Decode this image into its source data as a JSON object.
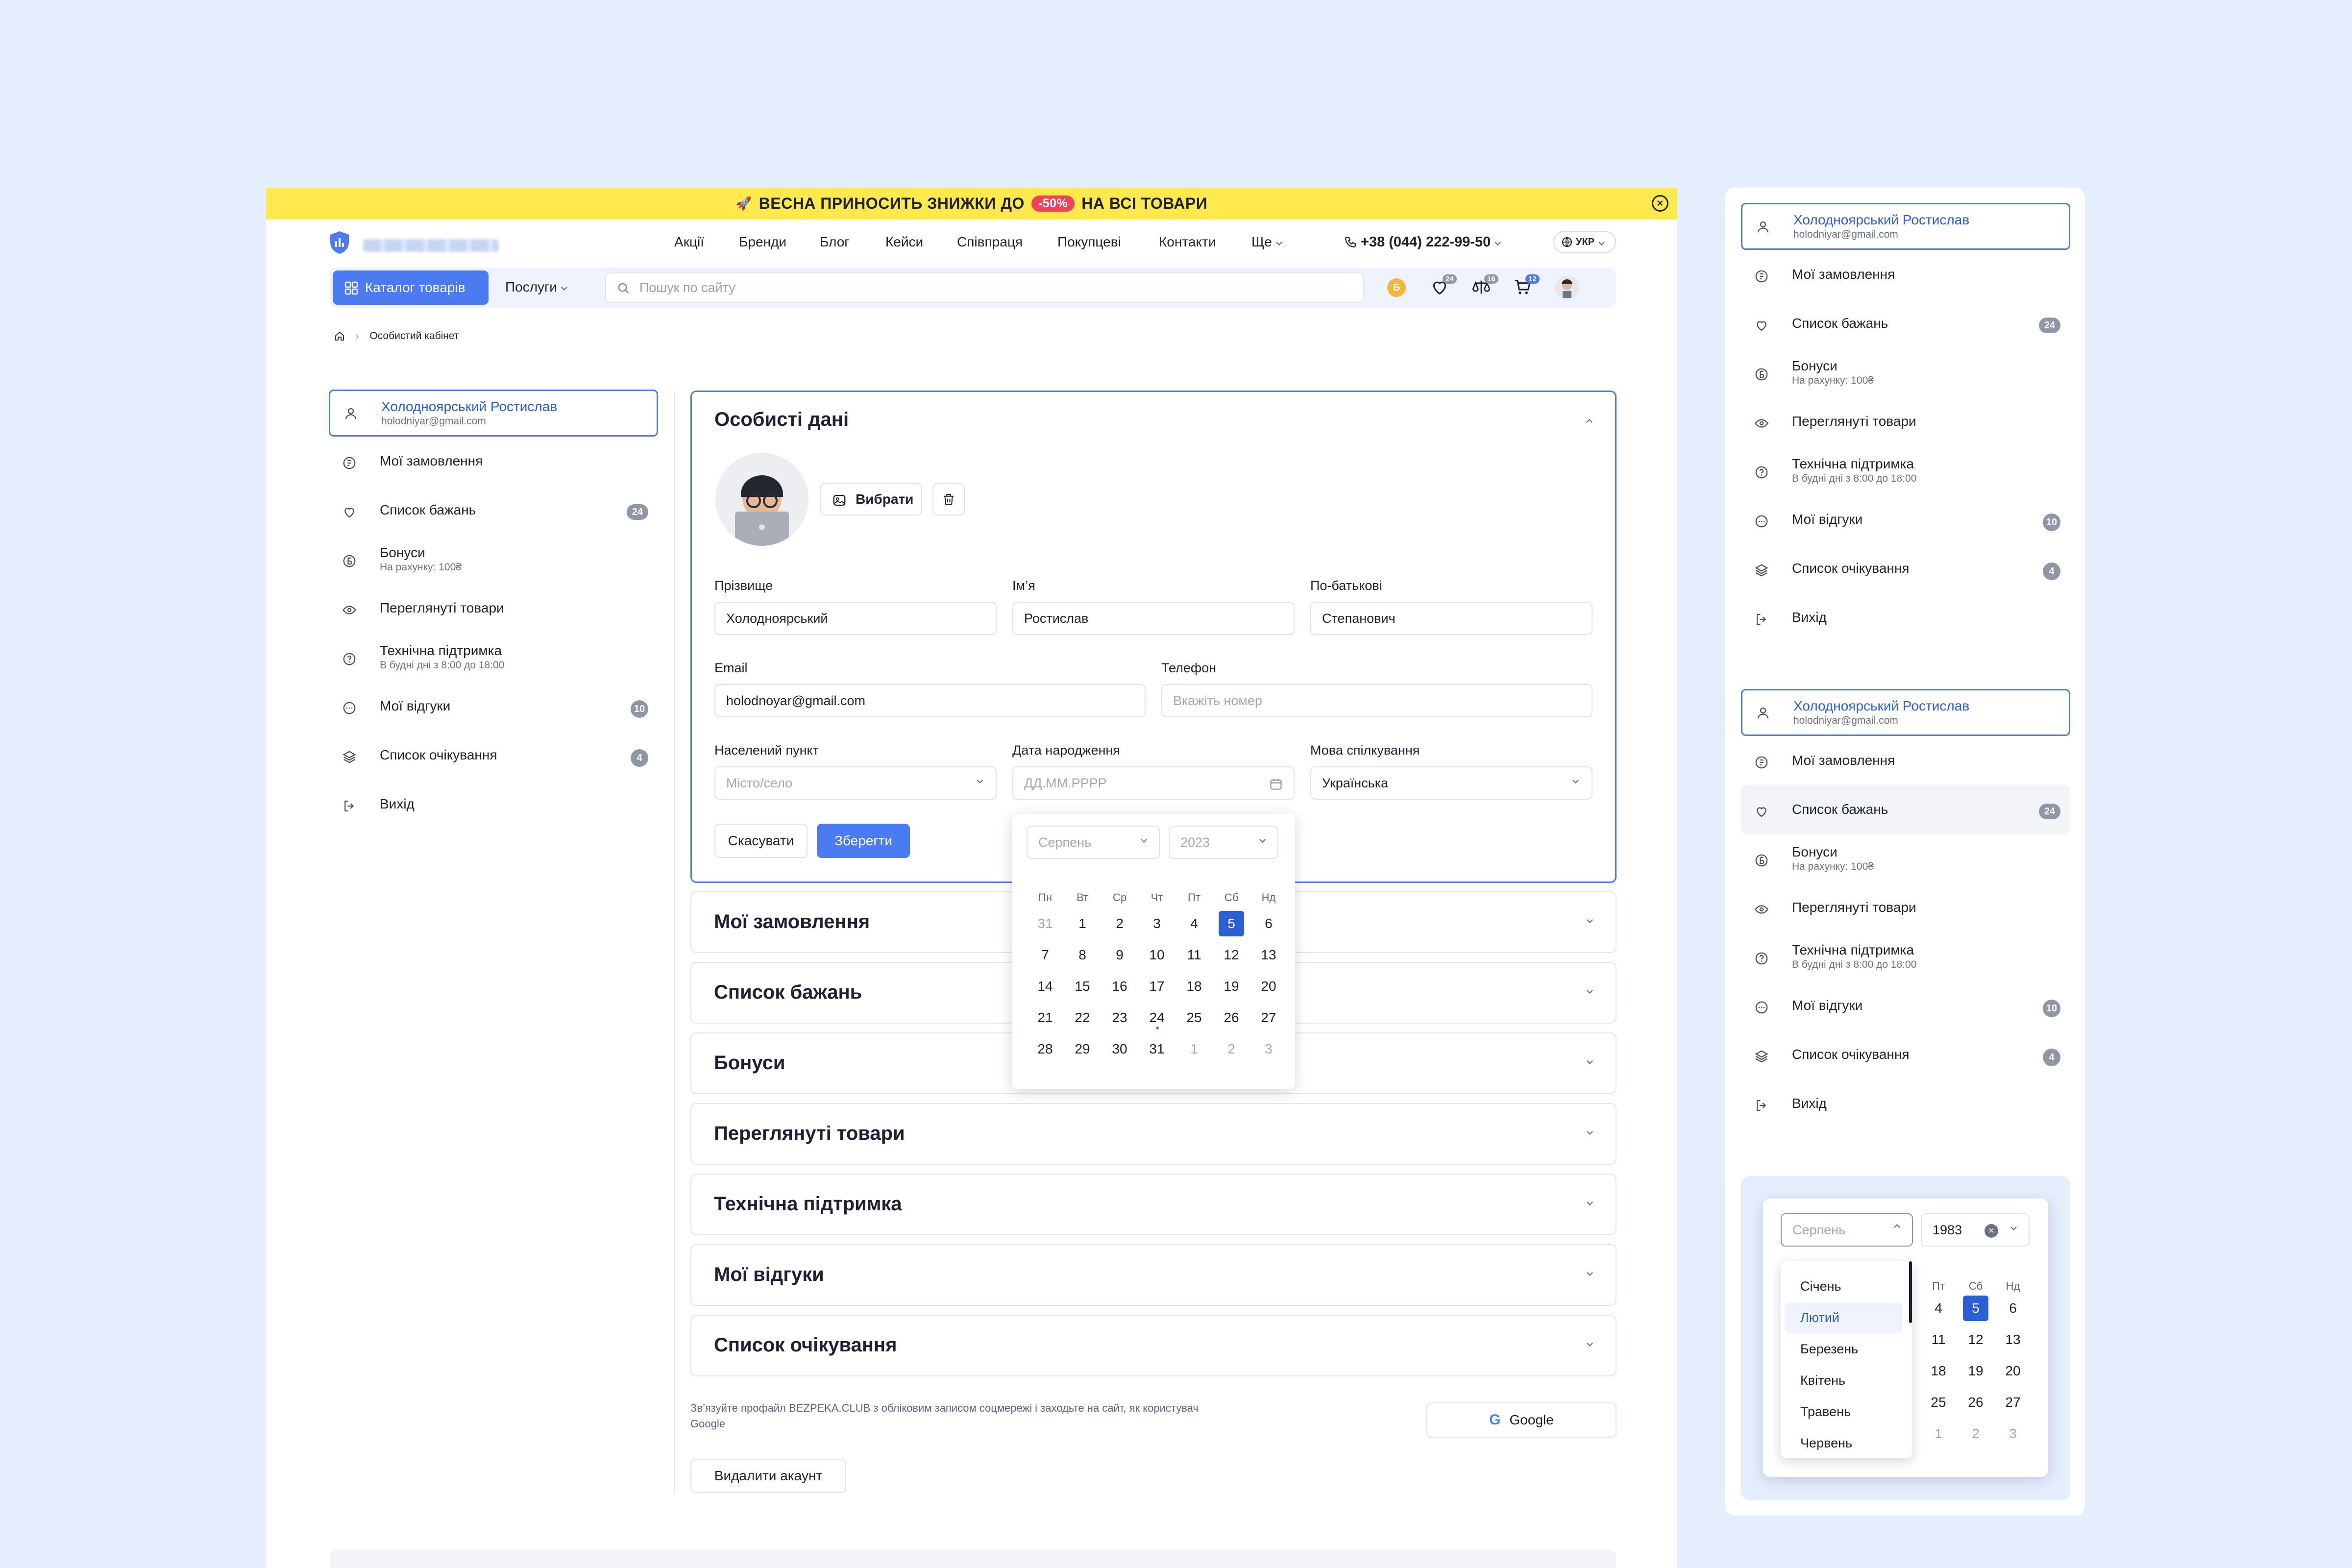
{
  "promo": {
    "prefix": "ВЕСНА ПРИНОСИТЬ ЗНИЖКИ ДО",
    "discount": "-50%",
    "suffix": "НА ВСІ ТОВАРИ"
  },
  "nav": {
    "links": [
      "Акції",
      "Бренди",
      "Блог",
      "Кейси",
      "Співпраця",
      "Покупцеві",
      "Контакти",
      "Ще"
    ],
    "phone": "+38 (044) 222-99-50",
    "lang": "УКР"
  },
  "toolbar": {
    "catalog": "Каталог товарів",
    "services": "Послуги",
    "search_placeholder": "Пошук по сайту",
    "bonus_letter": "Б",
    "wishlist_count": "24",
    "compare_count": "16",
    "cart_count": "12"
  },
  "breadcrumb": {
    "current": "Особистий кабінет"
  },
  "menu": {
    "profile_name": "Холодноярський Ростислав",
    "profile_email": "holodniyar@gmail.com",
    "orders": "Мої замовлення",
    "wishlist": "Список бажань",
    "wishlist_count": "24",
    "bonuses": "Бонуси",
    "bonuses_sub": "На рахунку: 100₴",
    "viewed": "Переглянуті товари",
    "support": "Технічна підтримка",
    "support_sub": "В будні дні з 8:00 до 18:00",
    "reviews": "Мої відгуки",
    "reviews_count": "10",
    "waitlist": "Список очікування",
    "waitlist_count": "4",
    "logout": "Вихід"
  },
  "personal": {
    "title": "Особисті дані",
    "choose": "Вибрати",
    "surname_label": "Прізвище",
    "surname": "Холодноярський",
    "name_label": "Ім’я",
    "name": "Ростислав",
    "patronymic_label": "По-батькові",
    "patronymic": "Степанович",
    "email_label": "Email",
    "email": "holodnoyar@gmail.com",
    "phone_label": "Телефон",
    "phone_placeholder": "Вкажіть номер",
    "city_label": "Населений пункт",
    "city_placeholder": "Місто/село",
    "birth_label": "Дата народження",
    "birth_placeholder": "ДД.ММ.РРРР",
    "lang_label": "Мова спілкування",
    "lang_value": "Українська",
    "cancel": "Скасувати",
    "save": "Зберегти"
  },
  "calendar": {
    "month": "Серпень",
    "year": "2023",
    "weekdays": [
      "Пн",
      "Вт",
      "Ср",
      "Чт",
      "Пт",
      "Сб",
      "Нд"
    ],
    "weeks": [
      [
        "31",
        "1",
        "2",
        "3",
        "4",
        "5",
        "6"
      ],
      [
        "7",
        "8",
        "9",
        "10",
        "11",
        "12",
        "13"
      ],
      [
        "14",
        "15",
        "16",
        "17",
        "18",
        "19",
        "20"
      ],
      [
        "21",
        "22",
        "23",
        "24",
        "25",
        "26",
        "27"
      ],
      [
        "28",
        "29",
        "30",
        "31",
        "1",
        "2",
        "3"
      ]
    ]
  },
  "accordions": [
    "Мої замовлення",
    "Список бажань",
    "Бонуси",
    "Переглянуті товари",
    "Технічна підтримка",
    "Мої відгуки",
    "Список очікування"
  ],
  "social": {
    "text": "Зв’язуйте профайл BEZPEKA.CLUB з обліковим записом соцмережі і заходьте на сайт, як користувач Google",
    "google": "Google"
  },
  "delete_account": "Видалити акаунт",
  "calendar_demo": {
    "month": "Серпень",
    "year": "1983",
    "months": [
      "Січень",
      "Лютий",
      "Березень",
      "Квітень",
      "Травень",
      "Червень"
    ],
    "weekdays": [
      "Пт",
      "Сб",
      "Нд"
    ],
    "weeks": [
      [
        "4",
        "5",
        "6"
      ],
      [
        "11",
        "12",
        "13"
      ],
      [
        "18",
        "19",
        "20"
      ],
      [
        "25",
        "26",
        "27"
      ],
      [
        "1",
        "2",
        "3"
      ]
    ]
  }
}
